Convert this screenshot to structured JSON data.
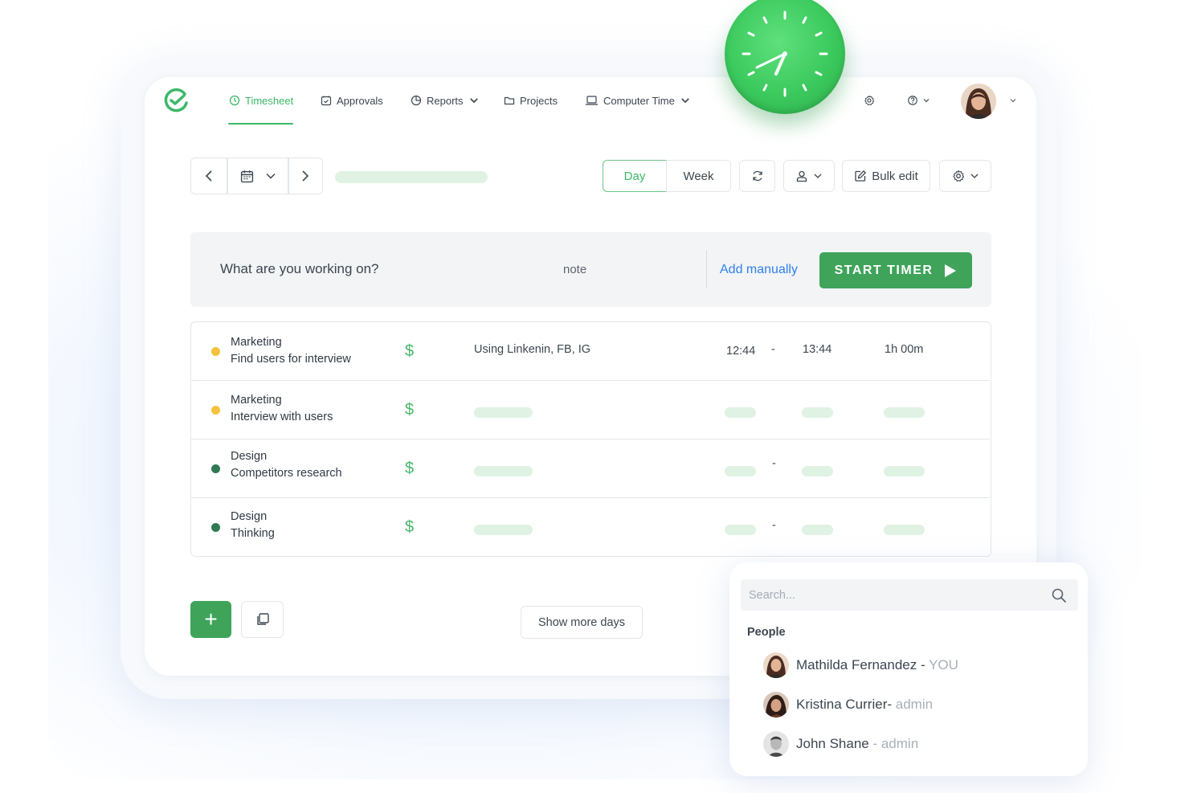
{
  "colors": {
    "accent": "#3fa45a",
    "active_nav": "#3cb868",
    "link": "#2f80ed",
    "dot_yellow": "#f5c23c",
    "dot_green": "#2f7a52"
  },
  "nav": {
    "items": [
      {
        "label": "Timesheet",
        "icon": "clock-icon"
      },
      {
        "label": "Approvals",
        "icon": "calendar-check-icon"
      },
      {
        "label": "Reports",
        "icon": "pie-chart-icon"
      },
      {
        "label": "Projects",
        "icon": "folder-icon"
      },
      {
        "label": "Computer Time",
        "icon": "laptop-icon"
      }
    ]
  },
  "toolbar": {
    "day": "Day",
    "week": "Week",
    "bulk_edit": "Bulk edit"
  },
  "timer": {
    "question": "What are you working on?",
    "note": "note",
    "add_manually": "Add manually",
    "start": "START TIMER"
  },
  "entries": [
    {
      "project": "Marketing",
      "task": "Find users for interview",
      "dot": "yellow",
      "description": "Using Linkenin, FB, IG",
      "start": "12:44",
      "separator": "-",
      "end": "13:44",
      "duration": "1h 00m"
    },
    {
      "project": "Marketing",
      "task": "Interview with users",
      "dot": "yellow"
    },
    {
      "project": "Design",
      "task": "Competitors research",
      "dot": "green",
      "separator": "-"
    },
    {
      "project": "Design",
      "task": "Thinking",
      "dot": "green",
      "separator": "-"
    }
  ],
  "billable_symbol": "$",
  "bottom": {
    "add": "+",
    "show_more": "Show more days"
  },
  "people_popup": {
    "search_placeholder": "Search...",
    "section": "People",
    "people": [
      {
        "name": "Mathilda Fernandez - ",
        "role": "YOU"
      },
      {
        "name": "Kristina Currier- ",
        "role": "admin"
      },
      {
        "name": "John Shane ",
        "role": "- admin"
      }
    ]
  }
}
